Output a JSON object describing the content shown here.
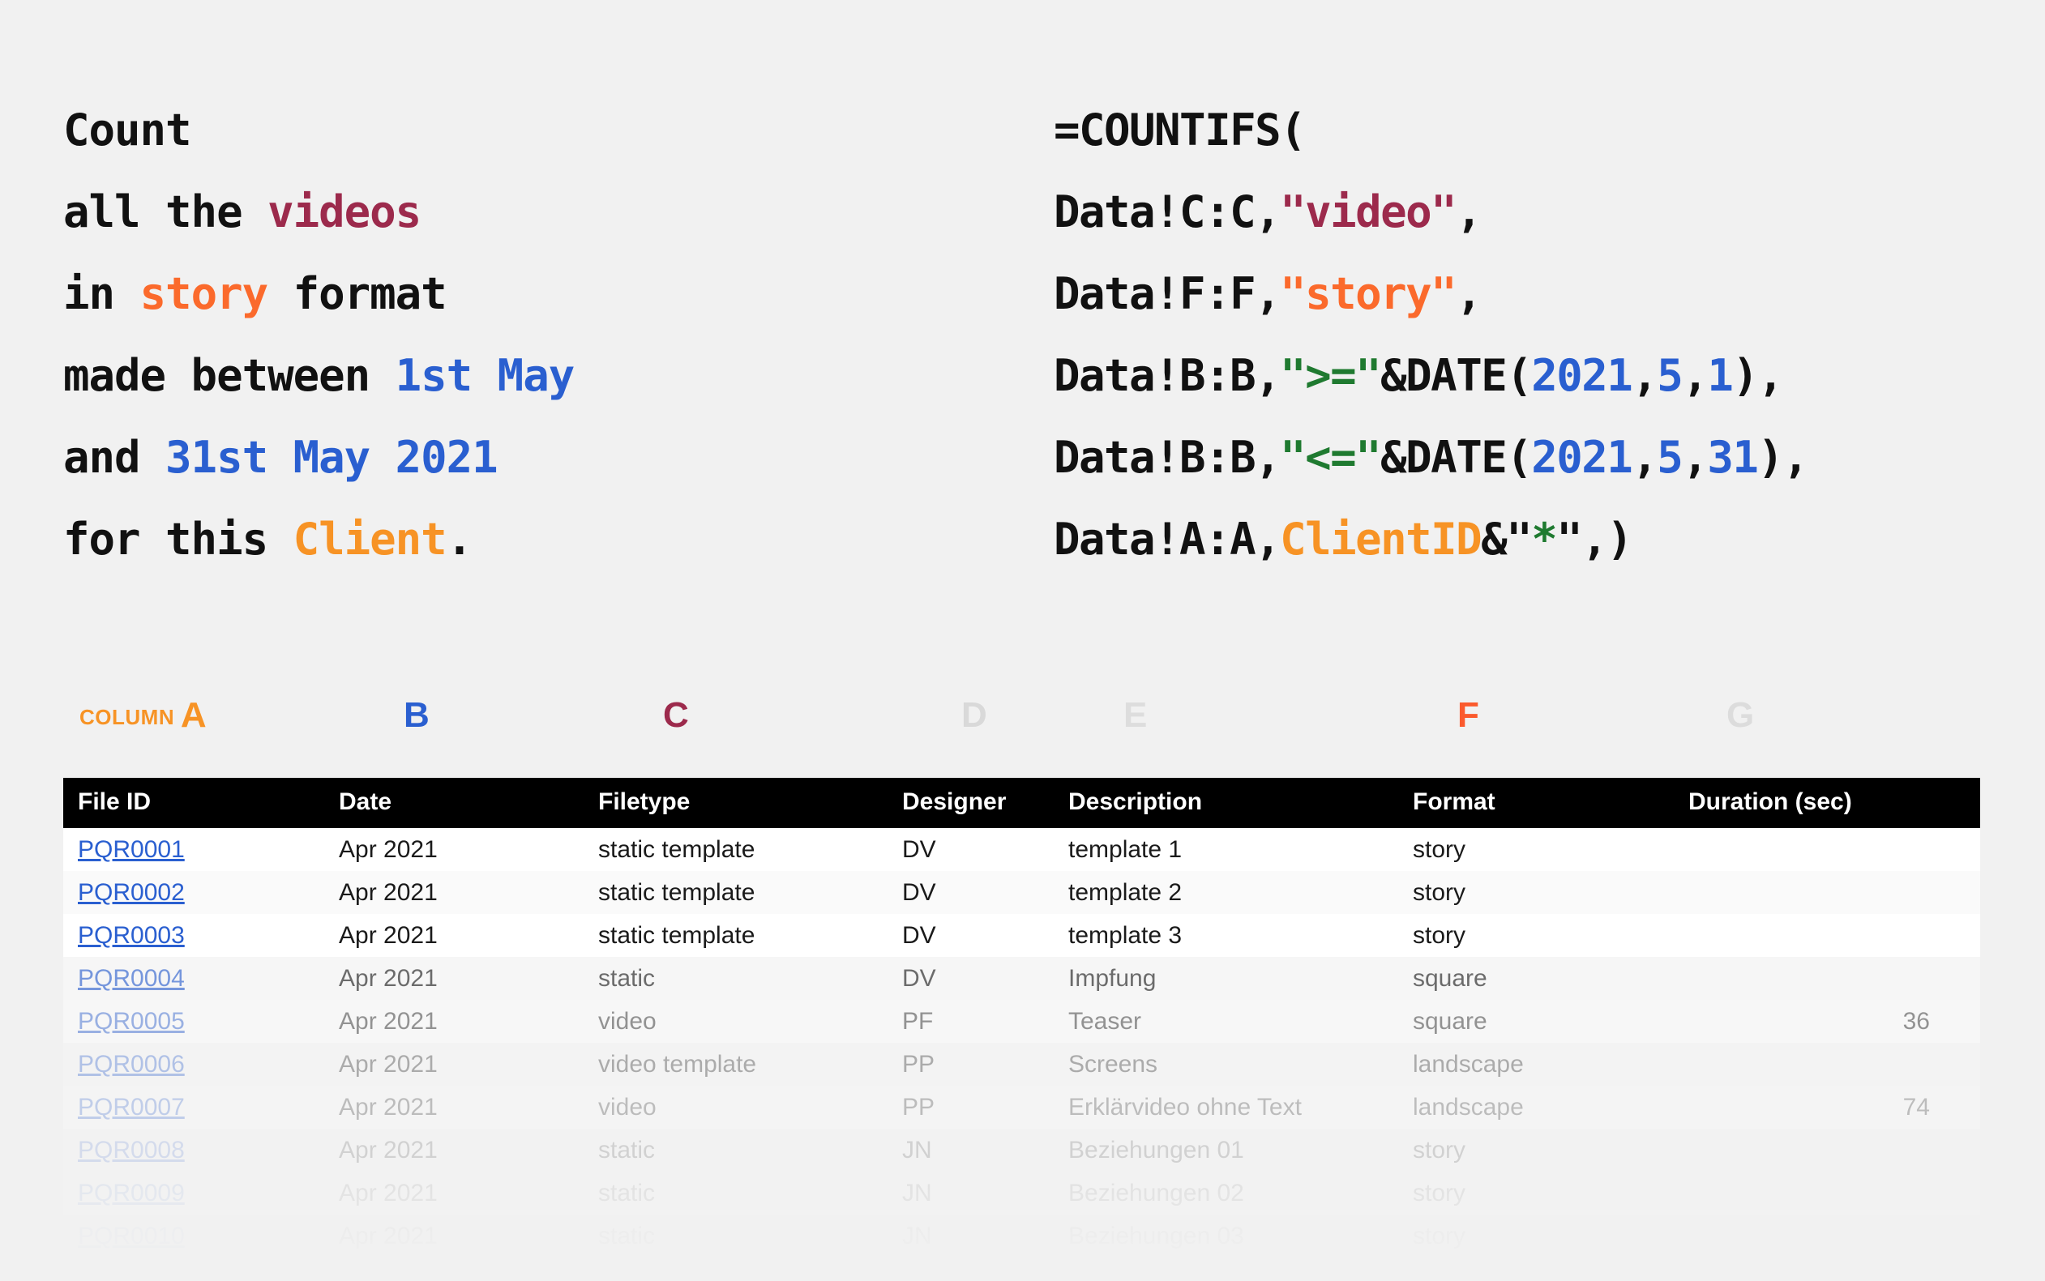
{
  "prose": {
    "lines": [
      [
        {
          "t": "Count",
          "c": "dark"
        }
      ],
      [
        {
          "t": "all the ",
          "c": "dark"
        },
        {
          "t": "videos",
          "c": "maroon"
        }
      ],
      [
        {
          "t": "in ",
          "c": "dark"
        },
        {
          "t": "story",
          "c": "orange"
        },
        {
          "t": " format",
          "c": "dark"
        }
      ],
      [
        {
          "t": "made between ",
          "c": "dark"
        },
        {
          "t": "1st May",
          "c": "blue"
        }
      ],
      [
        {
          "t": "and ",
          "c": "dark"
        },
        {
          "t": "31st May 2021",
          "c": "blue"
        }
      ],
      [
        {
          "t": "for this ",
          "c": "dark"
        },
        {
          "t": "Client",
          "c": "amber"
        },
        {
          "t": ".",
          "c": "dark"
        }
      ]
    ]
  },
  "formula": {
    "full_text": "=COUNTIFS(Data!C:C,\"video\",Data!F:F,\"story\",Data!B:B,\">=\"&DATE(2021,5,1),Data!B:B,\"<=\"&DATE(2021,5,31),Data!A:A,ClientID&\"*\",)",
    "lines": [
      [
        {
          "t": "=COUNTIFS(",
          "c": "dark"
        }
      ],
      [
        {
          "t": "Data!C:C,",
          "c": "dark"
        },
        {
          "t": "\"video\"",
          "c": "maroon"
        },
        {
          "t": ",",
          "c": "dark"
        }
      ],
      [
        {
          "t": "Data!F:F,",
          "c": "dark"
        },
        {
          "t": "\"story\"",
          "c": "orange"
        },
        {
          "t": ",",
          "c": "dark"
        }
      ],
      [
        {
          "t": "Data!B:B,",
          "c": "dark"
        },
        {
          "t": "\">=\"",
          "c": "green"
        },
        {
          "t": "&DATE(",
          "c": "dark"
        },
        {
          "t": "2021",
          "c": "blue"
        },
        {
          "t": ",",
          "c": "dark"
        },
        {
          "t": "5",
          "c": "blue"
        },
        {
          "t": ",",
          "c": "dark"
        },
        {
          "t": "1",
          "c": "blue"
        },
        {
          "t": "),",
          "c": "dark"
        }
      ],
      [
        {
          "t": "Data!B:B,",
          "c": "dark"
        },
        {
          "t": "\"<=\"",
          "c": "green"
        },
        {
          "t": "&DATE(",
          "c": "dark"
        },
        {
          "t": "2021",
          "c": "blue"
        },
        {
          "t": ",",
          "c": "dark"
        },
        {
          "t": "5",
          "c": "blue"
        },
        {
          "t": ",",
          "c": "dark"
        },
        {
          "t": "31",
          "c": "blue"
        },
        {
          "t": "),",
          "c": "dark"
        }
      ],
      [
        {
          "t": "Data!A:A,",
          "c": "dark"
        },
        {
          "t": "ClientID",
          "c": "amber"
        },
        {
          "t": "&",
          "c": "dark"
        },
        {
          "t": "\"",
          "c": "dark"
        },
        {
          "t": "*",
          "c": "green"
        },
        {
          "t": "\",)",
          "c": "dark"
        }
      ]
    ]
  },
  "column_strip": {
    "prefix_label": "COLUMN",
    "letters": [
      {
        "letter": "A",
        "color": "#f79325",
        "has_prefix": true
      },
      {
        "letter": "B",
        "color": "#2a5fd0",
        "has_prefix": false
      },
      {
        "letter": "C",
        "color": "#9c2a4c",
        "has_prefix": false
      },
      {
        "letter": "D",
        "color": "#d9d9d9",
        "has_prefix": false
      },
      {
        "letter": "E",
        "color": "#dddddd",
        "has_prefix": false
      },
      {
        "letter": "F",
        "color": "#fb5a2d",
        "has_prefix": false
      },
      {
        "letter": "G",
        "color": "#dcdcdc",
        "has_prefix": false
      }
    ]
  },
  "table": {
    "headers": [
      "File ID",
      "Date",
      "Filetype",
      "Designer",
      "Description",
      "Format",
      "Duration (sec)"
    ],
    "rows": [
      {
        "file_id": "PQR0001",
        "date": "Apr 2021",
        "filetype": "static template",
        "designer": "DV",
        "description": "template 1",
        "format": "story",
        "duration": ""
      },
      {
        "file_id": "PQR0002",
        "date": "Apr 2021",
        "filetype": "static template",
        "designer": "DV",
        "description": "template 2",
        "format": "story",
        "duration": ""
      },
      {
        "file_id": "PQR0003",
        "date": "Apr 2021",
        "filetype": "static template",
        "designer": "DV",
        "description": "template 3",
        "format": "story",
        "duration": ""
      },
      {
        "file_id": "PQR0004",
        "date": "Apr 2021",
        "filetype": "static",
        "designer": "DV",
        "description": "Impfung",
        "format": "square",
        "duration": ""
      },
      {
        "file_id": "PQR0005",
        "date": "Apr 2021",
        "filetype": "video",
        "designer": "PF",
        "description": "Teaser",
        "format": "square",
        "duration": "36"
      },
      {
        "file_id": "PQR0006",
        "date": "Apr 2021",
        "filetype": "video template",
        "designer": "PP",
        "description": "Screens",
        "format": "landscape",
        "duration": ""
      },
      {
        "file_id": "PQR0007",
        "date": "Apr 2021",
        "filetype": "video",
        "designer": "PP",
        "description": "Erklärvideo ohne Text",
        "format": "landscape",
        "duration": "74"
      },
      {
        "file_id": "PQR0008",
        "date": "Apr 2021",
        "filetype": "static",
        "designer": "JN",
        "description": "Beziehungen 01",
        "format": "story",
        "duration": ""
      },
      {
        "file_id": "PQR0009",
        "date": "Apr 2021",
        "filetype": "static",
        "designer": "JN",
        "description": "Beziehungen 02",
        "format": "story",
        "duration": ""
      },
      {
        "file_id": "PQR0010",
        "date": "Apr 2021",
        "filetype": "static",
        "designer": "JN",
        "description": "Beziehungen 03",
        "format": "story",
        "duration": ""
      }
    ]
  },
  "colors": {
    "background": "#f1f1f1",
    "header_bar": "#000000",
    "link": "#2a5fd0",
    "maroon": "#9c2a4c",
    "orange": "#fb6a2c",
    "amber": "#f79325",
    "green": "#1f7a30",
    "muted": "#d9d9d9"
  }
}
